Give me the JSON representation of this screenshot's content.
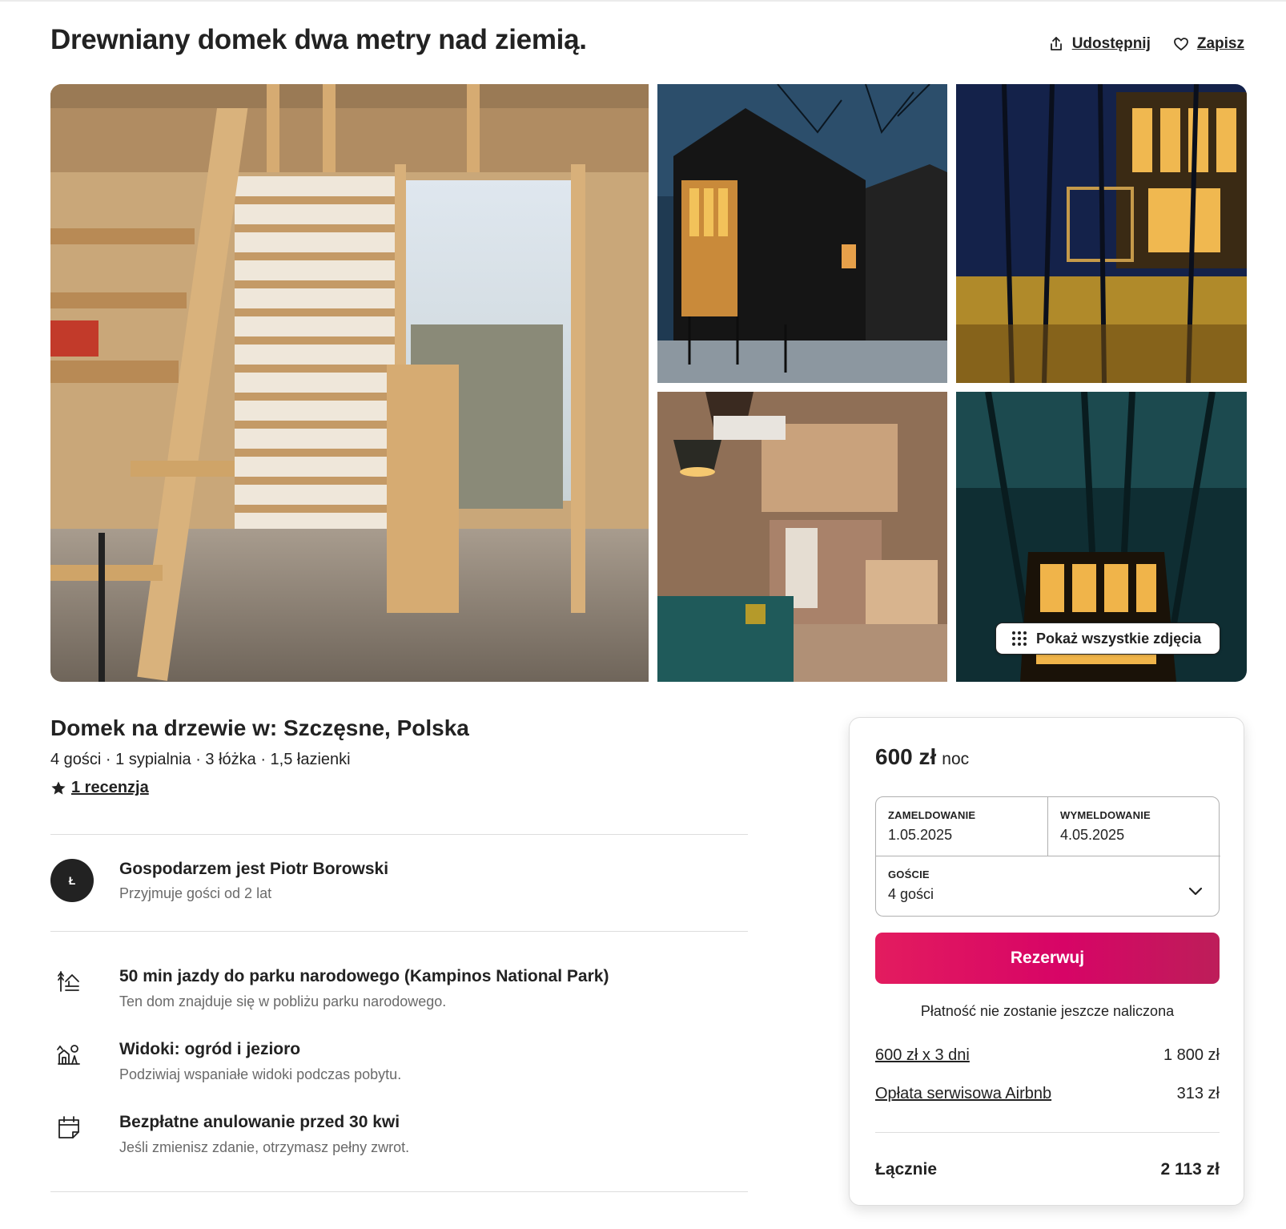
{
  "listing": {
    "title": "Drewniany domek dwa metry nad ziemią.",
    "share_label": "Udostępnij",
    "save_label": "Zapisz",
    "show_all_photos": "Pokaż wszystkie zdjęcia",
    "subtitle": "Domek na drzewie w: Szczęsne, Polska",
    "specs": "4 gości · 1 sypialnia · 3 łóżka · 1,5 łazienki",
    "review_link": "1 recenzja"
  },
  "host": {
    "initial": "Ł",
    "title": "Gospodarzem jest Piotr Borowski",
    "subtitle": "Przyjmuje gości od 2 lat"
  },
  "highlights": [
    {
      "icon": "park-icon",
      "title": "50 min jazdy do parku narodowego (Kampinos National Park)",
      "subtitle": "Ten dom znajduje się w pobliżu parku narodowego."
    },
    {
      "icon": "view-icon",
      "title": "Widoki: ogród i jezioro",
      "subtitle": "Podziwiaj wspaniałe widoki podczas pobytu."
    },
    {
      "icon": "calendar-icon",
      "title": "Bezpłatne anulowanie przed 30 kwi",
      "subtitle": "Jeśli zmienisz zdanie, otrzymasz pełny zwrot."
    }
  ],
  "booking": {
    "price": "600 zł",
    "price_unit": "noc",
    "checkin_label": "ZAMELDOWANIE",
    "checkin_value": "1.05.2025",
    "checkout_label": "WYMELDOWANIE",
    "checkout_value": "4.05.2025",
    "guests_label": "GOŚCIE",
    "guests_value": "4 gości",
    "reserve_label": "Rezerwuj",
    "no_charge_note": "Płatność nie zostanie jeszcze naliczona",
    "lines": [
      {
        "label": "600 zł x 3 dni",
        "amount": "1 800 zł"
      },
      {
        "label": "Opłata serwisowa Airbnb",
        "amount": "313 zł"
      }
    ],
    "total_label": "Łącznie",
    "total_amount": "2 113 zł"
  },
  "colors": {
    "text": "#222222",
    "muted": "#6a6a6a",
    "divider": "#dddddd",
    "brand": "#e31c5f"
  }
}
